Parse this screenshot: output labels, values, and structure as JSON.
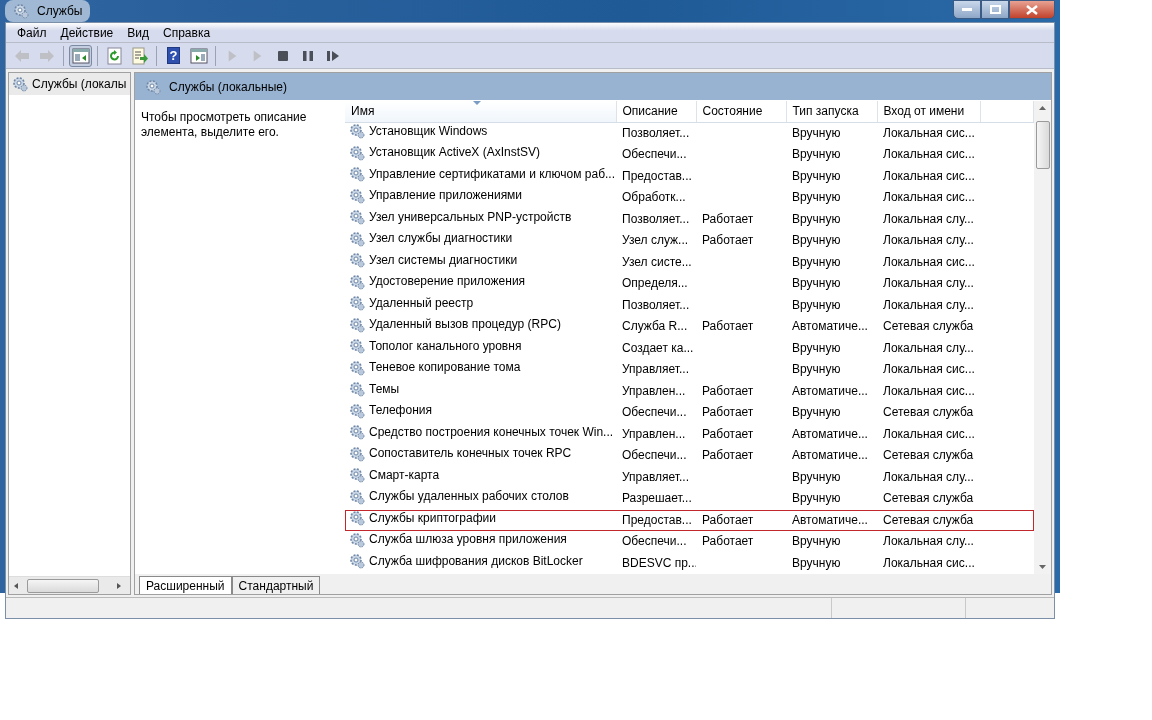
{
  "window": {
    "title": "Службы"
  },
  "menu": [
    "Файл",
    "Действие",
    "Вид",
    "Справка"
  ],
  "toolbar": [
    {
      "kind": "back",
      "disabled": true,
      "pressed": false
    },
    {
      "kind": "forward",
      "disabled": true,
      "pressed": false
    },
    {
      "kind": "sep"
    },
    {
      "kind": "tree",
      "disabled": false,
      "pressed": true
    },
    {
      "kind": "sep"
    },
    {
      "kind": "refresh",
      "disabled": false,
      "pressed": false
    },
    {
      "kind": "export",
      "disabled": false,
      "pressed": false
    },
    {
      "kind": "sep"
    },
    {
      "kind": "help",
      "glyph": "?",
      "disabled": false,
      "pressed": false
    },
    {
      "kind": "view",
      "disabled": false,
      "pressed": false
    },
    {
      "kind": "sep"
    },
    {
      "kind": "play",
      "disabled": true,
      "pressed": false
    },
    {
      "kind": "play",
      "disabled": true,
      "pressed": false
    },
    {
      "kind": "stop",
      "disabled": false,
      "pressed": false
    },
    {
      "kind": "pause",
      "disabled": false,
      "pressed": false
    },
    {
      "kind": "resume",
      "disabled": false,
      "pressed": false
    }
  ],
  "tree": {
    "items": [
      {
        "label": "Службы (локалы",
        "selected": true
      }
    ]
  },
  "pane": {
    "title": "Службы (локальные)",
    "description": "Чтобы просмотреть описание элемента, выделите его."
  },
  "table": {
    "columns": [
      {
        "label": "Имя",
        "sorted": true
      },
      {
        "label": "Описание",
        "sorted": false
      },
      {
        "label": "Состояние",
        "sorted": false
      },
      {
        "label": "Тип запуска",
        "sorted": false
      },
      {
        "label": "Вход от имени",
        "sorted": false
      }
    ],
    "rows": [
      {
        "cells": [
          "Установщик Windows",
          "Позволяет...",
          "",
          "Вручную",
          "Локальная сис..."
        ],
        "highlighted": false
      },
      {
        "cells": [
          "Установщик ActiveX (AxInstSV)",
          "Обеспечи...",
          "",
          "Вручную",
          "Локальная сис..."
        ],
        "highlighted": false
      },
      {
        "cells": [
          "Управление сертификатами и ключом раб...",
          "Предостав...",
          "",
          "Вручную",
          "Локальная сис..."
        ],
        "highlighted": false
      },
      {
        "cells": [
          "Управление приложениями",
          "Обработк...",
          "",
          "Вручную",
          "Локальная сис..."
        ],
        "highlighted": false
      },
      {
        "cells": [
          "Узел универсальных PNP-устройств",
          "Позволяет...",
          "Работает",
          "Вручную",
          "Локальная слу..."
        ],
        "highlighted": false
      },
      {
        "cells": [
          "Узел службы диагностики",
          "Узел служ...",
          "Работает",
          "Вручную",
          "Локальная слу..."
        ],
        "highlighted": false
      },
      {
        "cells": [
          "Узел системы диагностики",
          "Узел систе...",
          "",
          "Вручную",
          "Локальная сис..."
        ],
        "highlighted": false
      },
      {
        "cells": [
          "Удостоверение приложения",
          "Определя...",
          "",
          "Вручную",
          "Локальная слу..."
        ],
        "highlighted": false
      },
      {
        "cells": [
          "Удаленный реестр",
          "Позволяет...",
          "",
          "Вручную",
          "Локальная слу..."
        ],
        "highlighted": false
      },
      {
        "cells": [
          "Удаленный вызов процедур (RPC)",
          "Служба R...",
          "Работает",
          "Автоматиче...",
          "Сетевая служба"
        ],
        "highlighted": false
      },
      {
        "cells": [
          "Тополог канального уровня",
          "Создает ка...",
          "",
          "Вручную",
          "Локальная слу..."
        ],
        "highlighted": false
      },
      {
        "cells": [
          "Теневое копирование тома",
          "Управляет...",
          "",
          "Вручную",
          "Локальная сис..."
        ],
        "highlighted": false
      },
      {
        "cells": [
          "Темы",
          "Управлен...",
          "Работает",
          "Автоматиче...",
          "Локальная сис..."
        ],
        "highlighted": false
      },
      {
        "cells": [
          "Телефония",
          "Обеспечи...",
          "Работает",
          "Вручную",
          "Сетевая служба"
        ],
        "highlighted": false
      },
      {
        "cells": [
          "Средство построения конечных точек Win...",
          "Управлен...",
          "Работает",
          "Автоматиче...",
          "Локальная сис..."
        ],
        "highlighted": false
      },
      {
        "cells": [
          "Сопоставитель конечных точек RPC",
          "Обеспечи...",
          "Работает",
          "Автоматиче...",
          "Сетевая служба"
        ],
        "highlighted": false
      },
      {
        "cells": [
          "Смарт-карта",
          "Управляет...",
          "",
          "Вручную",
          "Локальная слу..."
        ],
        "highlighted": false
      },
      {
        "cells": [
          "Службы удаленных рабочих столов",
          "Разрешает...",
          "",
          "Вручную",
          "Сетевая служба"
        ],
        "highlighted": false
      },
      {
        "cells": [
          "Службы криптографии",
          "Предостав...",
          "Работает",
          "Автоматиче...",
          "Сетевая служба"
        ],
        "highlighted": true
      },
      {
        "cells": [
          "Служба шлюза уровня приложения",
          "Обеспечи...",
          "Работает",
          "Вручную",
          "Локальная слу..."
        ],
        "highlighted": false
      },
      {
        "cells": [
          "Служба шифрования дисков BitLocker",
          "BDESVC пр...",
          "",
          "Вручную",
          "Локальная сис..."
        ],
        "highlighted": false
      }
    ]
  },
  "tabs": [
    {
      "label": "Расширенный",
      "selected": true
    },
    {
      "label": "Стандартный",
      "selected": false
    }
  ]
}
